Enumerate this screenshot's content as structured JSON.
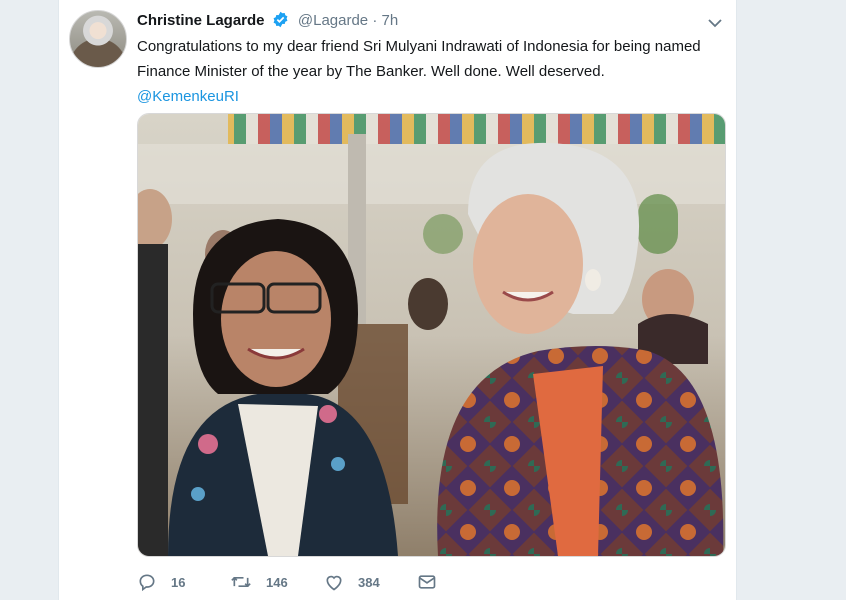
{
  "tweet": {
    "author_name": "Christine Lagarde",
    "handle": "@Lagarde",
    "separator": "·",
    "time": "7h",
    "text": "Congratulations to my dear friend Sri Mulyani Indrawati of Indonesia for being named Finance Minister of the year by The Banker. Well done. Well deserved.",
    "mention": "@KemenkeuRI"
  },
  "actions": {
    "reply_count": "16",
    "retweet_count": "146",
    "like_count": "384"
  },
  "icons": {
    "verified": "verified-badge-icon",
    "more": "chevron-down-icon",
    "reply": "reply-icon",
    "retweet": "retweet-icon",
    "like": "heart-icon",
    "dm": "envelope-icon"
  },
  "colors": {
    "link": "#1b95e0",
    "secondary_text": "#657786",
    "verified": "#1da1f2"
  }
}
